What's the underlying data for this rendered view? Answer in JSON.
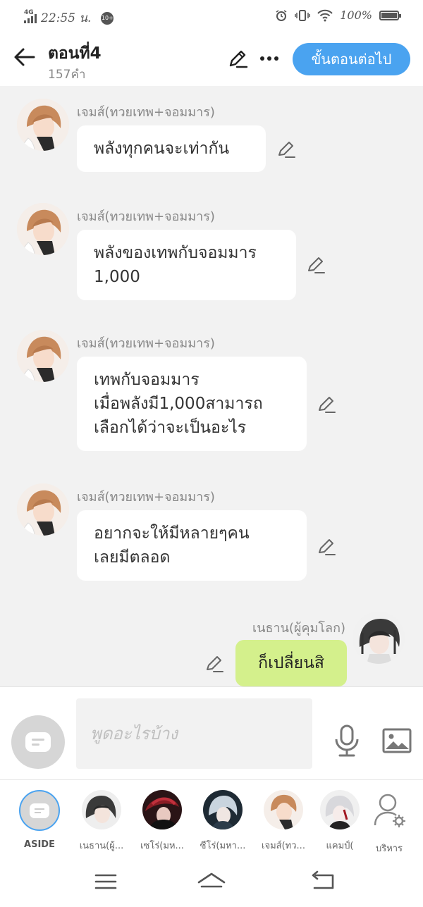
{
  "status_bar": {
    "network": "4G",
    "time": "22:55 น.",
    "notification_count": "10+",
    "battery": "100%"
  },
  "header": {
    "title": "ตอนที่4",
    "word_count": "157คำ",
    "next_button_label": "ขั้นตอนต่อไป"
  },
  "messages": [
    {
      "sender": "เจมส์(ทวยเทพ+จอมมาร)",
      "text": "พลังทุกคนจะเท่ากัน",
      "side": "left"
    },
    {
      "sender": "เจมส์(ทวยเทพ+จอมมาร)",
      "text": "พลังของเทพกับจอมมาร\n1,000",
      "side": "left"
    },
    {
      "sender": "เจมส์(ทวยเทพ+จอมมาร)",
      "text": "เทพกับจอมมาร\nเมื่อพลังมี1,000สามารถ\nเลือกได้ว่าจะเป็นอะไร",
      "side": "left"
    },
    {
      "sender": "เจมส์(ทวยเทพ+จอมมาร)",
      "text": "อยากจะให้มีหลายๆคน\nเลยมีตลอด",
      "side": "left"
    },
    {
      "sender": "เนธาน(ผู้คุมโลก)",
      "text": "ก็เปลี่ยนสิ",
      "side": "right"
    }
  ],
  "input": {
    "placeholder": "พูดอะไรบ้าง"
  },
  "characters": [
    {
      "label": "ASIDE"
    },
    {
      "label": "เนธาน(ผู้..."
    },
    {
      "label": "เซโร่(มห..."
    },
    {
      "label": "ซีโร่(มหา..."
    },
    {
      "label": "เจมส์(ทว..."
    },
    {
      "label": "แคมป์("
    },
    {
      "label": "บริหาร"
    }
  ],
  "colors": {
    "accent": "#4aa3f0",
    "my_bubble": "#d4f08c",
    "chat_background": "#f2f2f2"
  }
}
